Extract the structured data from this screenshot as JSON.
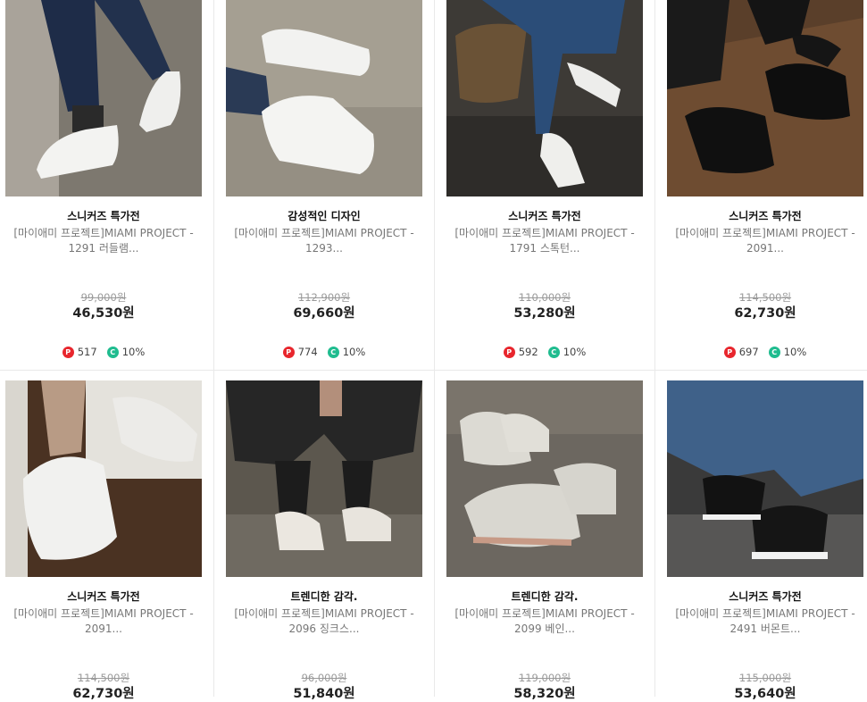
{
  "products": [
    {
      "title": "스니커즈 특가전",
      "desc": "[마이애미 프로젝트]MIAMI PROJECT - 1291 러들램...",
      "original_price": "99,000원",
      "price": "46,530원",
      "points": "517",
      "coupon": "10%",
      "image": "white-sneakers-on-feet"
    },
    {
      "title": "감성적인 디자인",
      "desc": "[마이애미 프로젝트]MIAMI PROJECT - 1293...",
      "original_price": "112,900원",
      "price": "69,660원",
      "points": "774",
      "coupon": "10%",
      "image": "white-sneakers-on-concrete"
    },
    {
      "title": "스니커즈 특가전",
      "desc": "[마이애미 프로젝트]MIAMI PROJECT - 1791 스톡턴...",
      "original_price": "110,000원",
      "price": "53,280원",
      "points": "592",
      "coupon": "10%",
      "image": "white-low-sneakers-jeans"
    },
    {
      "title": "스니커즈 특가전",
      "desc": "[마이애미 프로젝트]MIAMI PROJECT - 2091...",
      "original_price": "114,500원",
      "price": "62,730원",
      "points": "697",
      "coupon": "10%",
      "image": "black-chunky-sneakers"
    },
    {
      "title": "스니커즈 특가전",
      "desc": "[마이애미 프로젝트]MIAMI PROJECT - 2091...",
      "original_price": "114,500원",
      "price": "62,730원",
      "points": "",
      "coupon": "",
      "image": "white-chunky-sneakers"
    },
    {
      "title": "트렌디한 감각.",
      "desc": "[마이애미 프로젝트]MIAMI PROJECT - 2096 징크스...",
      "original_price": "96,000원",
      "price": "51,840원",
      "points": "",
      "coupon": "",
      "image": "grey-gum-sole-sneakers-on-feet"
    },
    {
      "title": "트렌디한 감각.",
      "desc": "[마이애미 프로젝트]MIAMI PROJECT - 2099 베인...",
      "original_price": "119,000원",
      "price": "58,320원",
      "points": "",
      "coupon": "",
      "image": "grey-gum-sole-sneakers-pair"
    },
    {
      "title": "스니커즈 특가전",
      "desc": "[마이애미 프로젝트]MIAMI PROJECT - 2491 버몬트...",
      "original_price": "115,000원",
      "price": "53,640원",
      "points": "",
      "coupon": "",
      "image": "black-white-sole-sneakers"
    }
  ],
  "badges": {
    "points_letter": "P",
    "coupon_letter": "C"
  },
  "colors": {
    "points_badge": "#e8262d",
    "coupon_badge": "#1fbc8f",
    "price": "#222222",
    "original_price": "#9a9a9a"
  }
}
